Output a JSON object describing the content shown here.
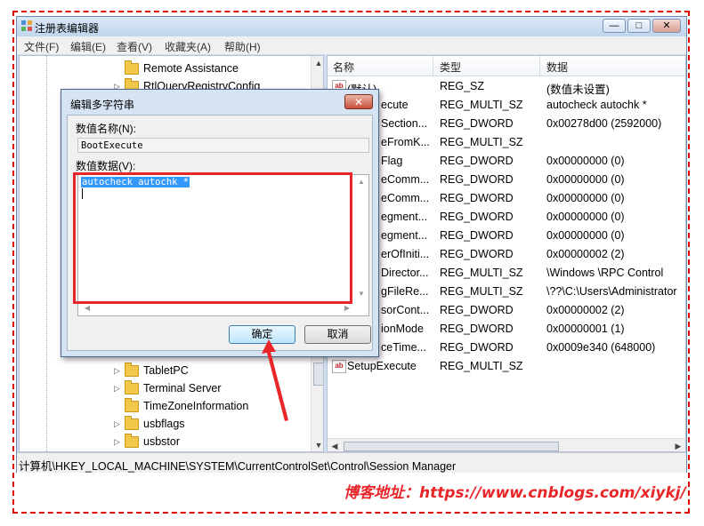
{
  "window": {
    "title": "注册表编辑器",
    "controls": {
      "minimize": "—",
      "maximize": "□",
      "close": "✕"
    }
  },
  "menu": [
    "文件(F)",
    "编辑(E)",
    "查看(V)",
    "收藏夹(A)",
    "帮助(H)"
  ],
  "tree": {
    "items_top": [
      "Remote Assistance",
      "RtlQueryRegistryConfig"
    ],
    "items_bottom": [
      "TabletPC",
      "Terminal Server",
      "TimeZoneInformation",
      "usbflags",
      "usbstor"
    ],
    "scroll": {
      "up": "▲",
      "down": "▼"
    },
    "expander": "▷"
  },
  "list": {
    "headers": {
      "name": "名称",
      "type": "类型",
      "data": "数据"
    },
    "rows": [
      {
        "name": "(默认)",
        "type": "REG_SZ",
        "data": "(数值未设置)"
      },
      {
        "name": "BootExecute",
        "type": "REG_MULTI_SZ",
        "data": "autocheck autochk *"
      },
      {
        "name": "CriticalSectionTimeout",
        "type": "REG_DWORD",
        "data": "0x00278d00 (2592000)"
      },
      {
        "name": "ExcludeFromKnownDlls",
        "type": "REG_MULTI_SZ",
        "data": ""
      },
      {
        "name": "GlobalFlag",
        "type": "REG_DWORD",
        "data": "0x00000000 (0)"
      },
      {
        "name": "HeapDeCommitFreeBlockThreshold",
        "type": "REG_DWORD",
        "data": "0x00000000 (0)"
      },
      {
        "name": "HeapDeCommitTotalFreeThreshold",
        "type": "REG_DWORD",
        "data": "0x00000000 (0)"
      },
      {
        "name": "HeapSegmentCommit",
        "type": "REG_DWORD",
        "data": "0x00000000 (0)"
      },
      {
        "name": "HeapSegmentReserve",
        "type": "REG_DWORD",
        "data": "0x00000000 (0)"
      },
      {
        "name": "NumberOfInitialSessions",
        "type": "REG_DWORD",
        "data": "0x00000002 (2)"
      },
      {
        "name": "ObjectDirectories",
        "type": "REG_MULTI_SZ",
        "data": "\\Windows \\RPC Control"
      },
      {
        "name": "PendingFileRenameOperations",
        "type": "REG_MULTI_SZ",
        "data": "\\??\\C:\\Users\\Administrator"
      },
      {
        "name": "ProcessorControl",
        "type": "REG_DWORD",
        "data": "0x00000002 (2)"
      },
      {
        "name": "ProtectionMode",
        "type": "REG_DWORD",
        "data": "0x00000001 (1)"
      },
      {
        "name": "ResourceTimeoutCount",
        "type": "REG_DWORD",
        "data": "0x0009e340 (648000)"
      },
      {
        "name": "SetupExecute",
        "type": "REG_MULTI_SZ",
        "data": ""
      }
    ],
    "visible_names": [
      "(默认)",
      "ecute",
      "Section...",
      "eFromK...",
      "Flag",
      "eComm...",
      "eComm...",
      "egment...",
      "egment...",
      "erOfIniti...",
      "Director...",
      "gFileRe...",
      "sorCont...",
      "ionMode",
      "ceTime...",
      "SetupExecute"
    ],
    "scroll": {
      "left": "◀",
      "right": "▶"
    }
  },
  "status": "计算机\\HKEY_LOCAL_MACHINE\\SYSTEM\\CurrentControlSet\\Control\\Session Manager",
  "dialog": {
    "title": "编辑多字符串",
    "close": "✕",
    "name_label": "数值名称(N):",
    "name_value": "BootExecute",
    "data_label": "数值数据(V):",
    "data_value": "autocheck autochk *",
    "ok_label": "确定",
    "cancel_label": "取消",
    "scroll": {
      "up": "▲",
      "down": "▼",
      "left": "◀",
      "right": "▶"
    }
  },
  "watermark": "博客地址：https://www.cnblogs.com/xiykj/",
  "colors": {
    "annotation_red": "#e8262a",
    "selection_blue": "#3399ff"
  }
}
